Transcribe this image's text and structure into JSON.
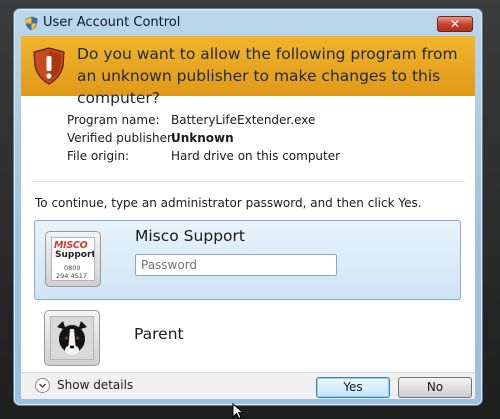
{
  "window": {
    "title": "User Account Control",
    "close_label": "✕"
  },
  "banner": {
    "question": "Do you want to allow the following program from an unknown publisher to make changes to this computer?"
  },
  "details": {
    "rows": [
      {
        "label": "Program name:",
        "value": "BatteryLifeExtender.exe"
      },
      {
        "label": "Verified publisher:",
        "value": "Unknown"
      },
      {
        "label": "File origin:",
        "value": "Hard drive on this computer"
      }
    ]
  },
  "instruction": "To continue, type an administrator password, and then click Yes.",
  "accounts": [
    {
      "name": "Misco Support",
      "avatar": {
        "logo": "MISCO",
        "caption": "Support",
        "line1": "0800",
        "line2": "294 4517"
      },
      "password_placeholder": "Password"
    },
    {
      "name": "Parent",
      "avatar_icon": "dog-photo"
    }
  ],
  "footer": {
    "show_details": "Show details",
    "yes": "Yes",
    "no": "No"
  },
  "colors": {
    "banner": "#e8a623",
    "selected_tile": "#d8e9f6",
    "window_frame": "#a9c8e2",
    "close_button": "#c2412a"
  },
  "icons": [
    "uac-shield-icon",
    "warning-shield-icon",
    "chevron-down-icon",
    "mouse-cursor-icon"
  ]
}
